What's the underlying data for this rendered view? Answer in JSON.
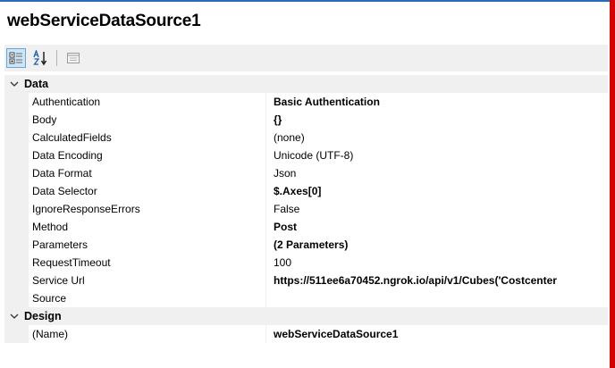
{
  "title": "webServiceDataSource1",
  "toolbar": {
    "categorized_icon": "categorized-icon",
    "alphabetical_icon": "sort-alphabetical-icon",
    "property_pages_icon": "property-pages-icon"
  },
  "categories": [
    {
      "label": "Data",
      "properties": [
        {
          "name": "Authentication",
          "value": "Basic Authentication",
          "bold": true
        },
        {
          "name": "Body",
          "value": "{}",
          "bold": true
        },
        {
          "name": "CalculatedFields",
          "value": "(none)",
          "bold": false
        },
        {
          "name": "Data Encoding",
          "value": "Unicode (UTF-8)",
          "bold": false
        },
        {
          "name": "Data Format",
          "value": "Json",
          "bold": false
        },
        {
          "name": "Data Selector",
          "value": "$.Axes[0]",
          "bold": true
        },
        {
          "name": "IgnoreResponseErrors",
          "value": "False",
          "bold": false
        },
        {
          "name": "Method",
          "value": "Post",
          "bold": true
        },
        {
          "name": "Parameters",
          "value": "(2 Parameters)",
          "bold": true
        },
        {
          "name": "RequestTimeout",
          "value": "100",
          "bold": false
        },
        {
          "name": "Service Url",
          "value": "https://511ee6a70452.ngrok.io/api/v1/Cubes('Costcenter",
          "bold": true
        },
        {
          "name": "Source",
          "value": "",
          "bold": false
        }
      ]
    },
    {
      "label": "Design",
      "properties": [
        {
          "name": "(Name)",
          "value": "webServiceDataSource1",
          "bold": true
        }
      ]
    }
  ],
  "colors": {
    "accent": "#2a6ab8",
    "selection_border": "#d20000",
    "gutter": "#f0f0f0"
  }
}
